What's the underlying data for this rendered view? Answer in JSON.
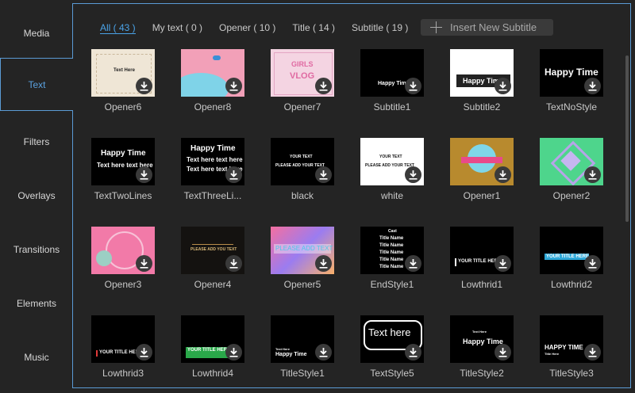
{
  "sidebar": {
    "items": [
      {
        "label": "Media"
      },
      {
        "label": "Text"
      },
      {
        "label": "Filters"
      },
      {
        "label": "Overlays"
      },
      {
        "label": "Transitions"
      },
      {
        "label": "Elements"
      },
      {
        "label": "Music"
      }
    ],
    "active_index": 1
  },
  "tabs": [
    {
      "label": "All ( 43 )"
    },
    {
      "label": "My text ( 0 )"
    },
    {
      "label": "Opener ( 10 )"
    },
    {
      "label": "Title ( 14 )"
    },
    {
      "label": "Subtitle ( 19 )"
    }
  ],
  "insert_button": {
    "label": "Insert New Subtitle"
  },
  "tiles": [
    {
      "label": "Opener6",
      "thumb_text": [
        "Text Here"
      ],
      "theme": "cream"
    },
    {
      "label": "Opener8",
      "thumb_text": [],
      "theme": "pink-blue"
    },
    {
      "label": "Opener7",
      "thumb_text": [
        "GIRLS",
        "VLOG"
      ],
      "theme": "pink-grid"
    },
    {
      "label": "Subtitle1",
      "thumb_text": [
        "Happy Time"
      ],
      "theme": "black-small"
    },
    {
      "label": "Subtitle2",
      "thumb_text": [
        "Happy Time"
      ],
      "theme": "white-bar"
    },
    {
      "label": "TextNoStyle",
      "thumb_text": [
        "Happy Time"
      ],
      "theme": "black-big"
    },
    {
      "label": "TextTwoLines",
      "thumb_text": [
        "Happy Time",
        "Text here text here"
      ],
      "theme": "black-two"
    },
    {
      "label": "TextThreeLi...",
      "thumb_text": [
        "Happy Time",
        "Text here text here",
        "Text here text here"
      ],
      "theme": "black-three"
    },
    {
      "label": "black",
      "thumb_text": [
        "YOUR TEXT",
        "PLEASE ADD YOUR TEXT"
      ],
      "theme": "black-caps"
    },
    {
      "label": "white",
      "thumb_text": [
        "YOUR TEXT",
        "PLEASE ADD YOUR TEXT"
      ],
      "theme": "white-caps"
    },
    {
      "label": "Opener1",
      "thumb_text": [],
      "theme": "gold-badge"
    },
    {
      "label": "Opener2",
      "thumb_text": [],
      "theme": "green-diamond"
    },
    {
      "label": "Opener3",
      "thumb_text": [],
      "theme": "pink-wreath"
    },
    {
      "label": "Opener4",
      "thumb_text": [
        "PLEASE ADD YOU TEXT"
      ],
      "theme": "dark-ornate"
    },
    {
      "label": "Opener5",
      "thumb_text": [
        "PLEASE ADD TEXT"
      ],
      "theme": "gradient"
    },
    {
      "label": "EndStyle1",
      "thumb_text": [
        "Cast",
        "Title Name",
        "Title Name",
        "Title Name",
        "Title Name",
        "Title Name"
      ],
      "theme": "credits"
    },
    {
      "label": "Lowthrid1",
      "thumb_text": [
        "YOUR TITLE HERE"
      ],
      "theme": "lower1"
    },
    {
      "label": "Lowthrid2",
      "thumb_text": [
        "YOUR TITLE HERE"
      ],
      "theme": "lower2"
    },
    {
      "label": "Lowthrid3",
      "thumb_text": [
        "YOUR TITLE HERE"
      ],
      "theme": "lower3"
    },
    {
      "label": "Lowthrid4",
      "thumb_text": [
        "YOUR TITLE HERE"
      ],
      "theme": "lower4"
    },
    {
      "label": "TitleStyle1",
      "thumb_text": [
        "Text Here",
        "Happy Time"
      ],
      "theme": "title1"
    },
    {
      "label": "TextStyle5",
      "thumb_text": [
        "Text here"
      ],
      "theme": "bubble"
    },
    {
      "label": "TitleStyle2",
      "thumb_text": [
        "Text Here",
        "Happy Time"
      ],
      "theme": "title2"
    },
    {
      "label": "TitleStyle3",
      "thumb_text": [
        "HAPPY TIME",
        "Title Here"
      ],
      "theme": "title3"
    }
  ],
  "colors": {
    "accent": "#4aa3e8",
    "border": "#5b9bd5",
    "background": "#242424"
  }
}
